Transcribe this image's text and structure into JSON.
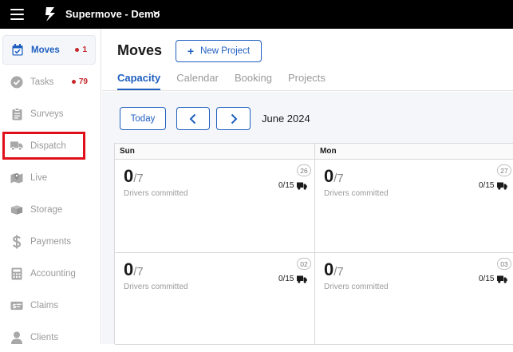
{
  "app": {
    "title": "Supermove - Demo",
    "accent_color": "#1f5fbf",
    "alert_color": "#c4282b",
    "highlight_color": "#e0101a"
  },
  "sidebar": {
    "items": [
      {
        "label": "Moves",
        "icon": "calendar-check-icon",
        "active": true,
        "badge": "1"
      },
      {
        "label": "Tasks",
        "icon": "check-circle-icon",
        "active": false,
        "badge": "79"
      },
      {
        "label": "Surveys",
        "icon": "clipboard-icon",
        "active": false
      },
      {
        "label": "Dispatch",
        "icon": "truck-icon",
        "active": false
      },
      {
        "label": "Live",
        "icon": "map-marker-icon",
        "active": false
      },
      {
        "label": "Storage",
        "icon": "box-icon",
        "active": false
      },
      {
        "label": "Payments",
        "icon": "dollar-icon",
        "active": false
      },
      {
        "label": "Accounting",
        "icon": "calculator-icon",
        "active": false
      },
      {
        "label": "Claims",
        "icon": "money-check-icon",
        "active": false
      },
      {
        "label": "Clients",
        "icon": "user-icon",
        "active": false
      }
    ]
  },
  "header": {
    "title": "Moves",
    "new_project_label": "New Project",
    "tabs": [
      {
        "label": "Capacity",
        "active": true
      },
      {
        "label": "Calendar",
        "active": false
      },
      {
        "label": "Booking",
        "active": false
      },
      {
        "label": "Projects",
        "active": false
      }
    ]
  },
  "toolbar": {
    "today_label": "Today",
    "month_label": "June 2024"
  },
  "calendar": {
    "days": [
      "Sun",
      "Mon"
    ],
    "cells": [
      {
        "date": "26",
        "committed": "0",
        "capacity": "/7",
        "label": "Drivers committed",
        "trucks": "0/15"
      },
      {
        "date": "27",
        "committed": "0",
        "capacity": "/7",
        "label": "Drivers committed",
        "trucks": "0/15"
      },
      {
        "date": "02",
        "committed": "0",
        "capacity": "/7",
        "label": "Drivers committed",
        "trucks": "0/15"
      },
      {
        "date": "03",
        "committed": "0",
        "capacity": "/7",
        "label": "Drivers committed",
        "trucks": "0/15"
      }
    ]
  }
}
